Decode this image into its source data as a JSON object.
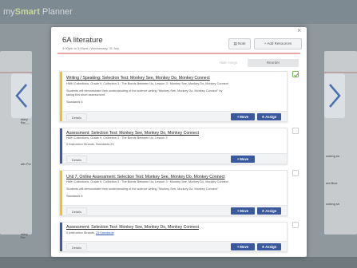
{
  "app": {
    "brand_prefix": "my",
    "brand_main": "Smart",
    "brand_suffix": " Planner"
  },
  "backdrop": {
    "left_card": {
      "items": [
        "ntary Per",
        "nting an",
        "ntation",
        "atic Per"
      ],
      "more": [
        "ntary Per",
        "nting an"
      ]
    },
    "right_card": {
      "items": [
        "sketch",
        "ooking an",
        "ard Busi",
        "ooking an"
      ]
    }
  },
  "modal": {
    "title": "6A literature",
    "subtitle": "3:00pm to 3:45pm | Wednesday, 31 July",
    "note_label": "Note",
    "add_resources_label": "+ Add Resources",
    "tab_hide": "Hide Assgn",
    "tab_active": "Reorder",
    "close": "×",
    "cards": [
      {
        "bar": "yellow",
        "title": "Writing / Speaking: Selection Test: Monkey See, Monkey Do, Monkey Connect",
        "line1": "HMH Collections, Grade 9, Collection 3 : The Bonds Between Us, Lesson 3 : Monkey See, Monkey Do, Monkey Connect",
        "line2": "Students will demonstrate their understanding of the science writing \"Monkey See, Monkey Do, Monkey Connect\" by",
        "line3": "taking this short assessment.",
        "line4": "Standards 6",
        "details": "Details",
        "move": "+ Move",
        "assign": "Assign"
      },
      {
        "bar": "blue",
        "title": "Assessment: Selection Test: Monkey See, Monkey Do, Monkey Connect",
        "line1": "HMH Collections, Grade 9, Collection 3 : The Bonds Between Us, Lesson 3",
        "line2": "0 Instruction Strands,  Standards 23",
        "details": "Details",
        "move": "+ Move"
      },
      {
        "bar": "yellow",
        "title": "Unit 7, Online Assessment: Selection Test: Monkey See, Monkey Do, Monkey Connect",
        "line1": "HMH Collections, Grade 9, Collection 3 : The Bonds Between Us, Lesson 3 : Monkey See, Monkey Do, Monkey Connect",
        "line2": "Students will demonstrate their understanding of the science writing \"Monkey See, Monkey Do, Monkey Connect\"",
        "line3": "Standards 6",
        "details": "Details",
        "move": "+ Move",
        "assign": "Assign"
      },
      {
        "bar": "blue",
        "title": "Assessment: Selection Test: Monkey See, Monkey Do, Monkey Connect",
        "line1_prefix": "0 Instruction Strands, ",
        "line1_link": "23 Standards",
        "details": "Details",
        "move": "+ Move",
        "assign": "Assign"
      }
    ]
  },
  "colors": {
    "accent_blue": "#3a5a9d",
    "accent_yellow": "#f3c21c",
    "rule_red": "#e8a6a8",
    "check_green": "#7bb661"
  }
}
